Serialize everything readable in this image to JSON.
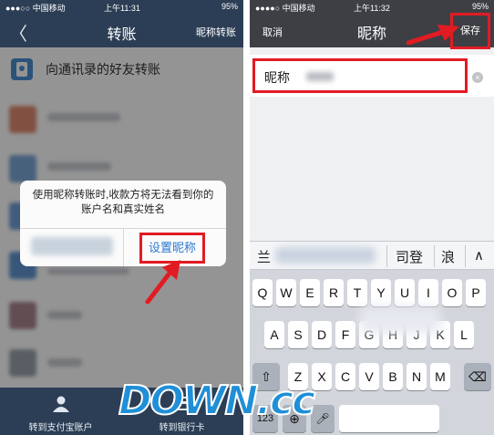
{
  "left": {
    "status": {
      "carrier": "●●●○○ 中国移动",
      "time": "上午11:31",
      "battery": "95%"
    },
    "header": {
      "back": "〈",
      "title": "转账",
      "right": "昵称转账"
    },
    "contacts_row": "向通讯录的好友转账",
    "dialog": {
      "message": "使用昵称转账时,收款方将无法看到你的账户名和真实姓名",
      "confirm": "设置昵称"
    },
    "tabs": [
      {
        "label": "转到支付宝账户",
        "icon": "person-icon"
      },
      {
        "label": "转到银行卡",
        "icon": "bank-card-icon"
      }
    ]
  },
  "right": {
    "status": {
      "carrier": "●●●●○ 中国移动",
      "time": "上午11:32",
      "battery": "95%"
    },
    "header": {
      "cancel": "取消",
      "title": "昵称",
      "save": "保存"
    },
    "field": {
      "label": "昵称",
      "clear": "×"
    },
    "candidates": [
      "兰",
      "司登",
      "浪",
      "∧"
    ],
    "keyboard": {
      "row1": [
        "Q",
        "W",
        "E",
        "R",
        "T",
        "Y",
        "U",
        "I",
        "O",
        "P"
      ],
      "row2": [
        "A",
        "S",
        "D",
        "F",
        "G",
        "H",
        "J",
        "K",
        "L"
      ],
      "row3": [
        "Z",
        "X",
        "C",
        "V",
        "B",
        "N",
        "M"
      ],
      "num": "123",
      "globe": "⊕",
      "mic": "🎤︎"
    }
  },
  "watermark": "DOWN.cc",
  "colors": {
    "highlight": "#e21b23",
    "nav_left": "#2c3e55",
    "nav_right": "#3e3f44",
    "link": "#2b79d0"
  }
}
